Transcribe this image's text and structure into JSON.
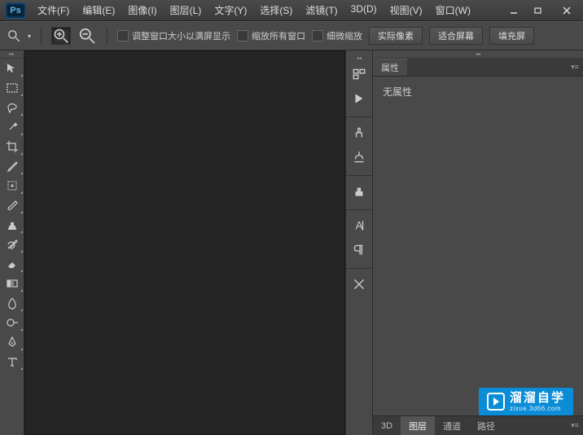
{
  "ps_logo": "Ps",
  "menu": {
    "file": "文件(F)",
    "edit": "编辑(E)",
    "image": "图像(I)",
    "layer": "图层(L)",
    "type": "文字(Y)",
    "select": "选择(S)",
    "filter": "滤镜(T)",
    "threeD": "3D(D)",
    "view": "视图(V)",
    "window": "窗口(W)"
  },
  "options": {
    "resize_fit": "调整窗口大小以满屏显示",
    "zoom_all": "缩放所有窗口",
    "scrubby": "细微缩放",
    "actual_pixels": "实际像素",
    "fit_screen": "适合屏幕",
    "fill_screen": "填充屏"
  },
  "properties_panel": {
    "tab": "属性",
    "empty": "无属性"
  },
  "bottom_tabs": {
    "threeD": "3D",
    "layers": "图层",
    "channels": "通道",
    "paths": "路径"
  },
  "watermark": {
    "text": "溜溜自学",
    "url": "zixue.3d66.com"
  }
}
